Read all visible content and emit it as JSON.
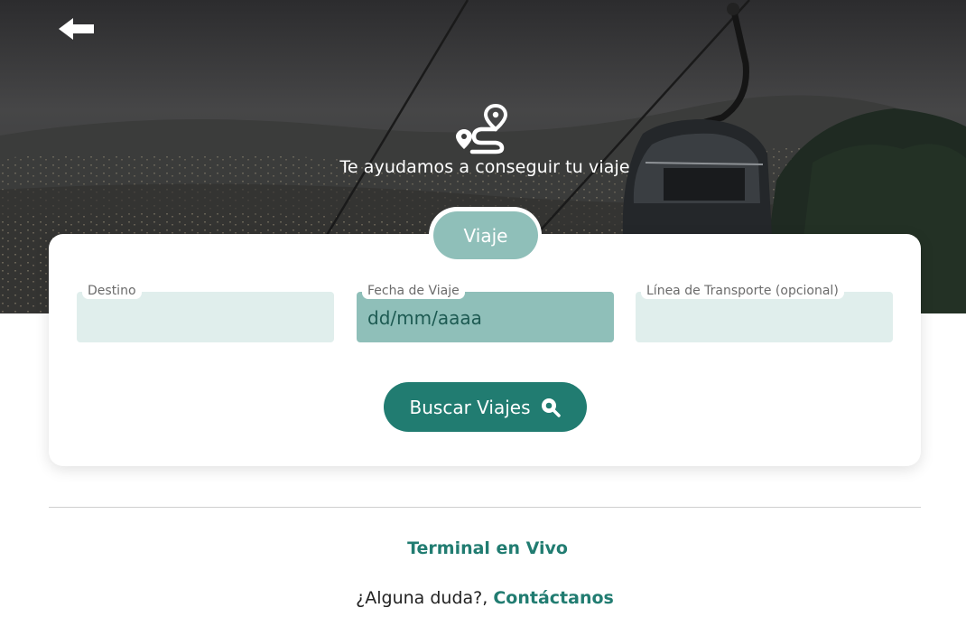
{
  "header": {
    "back_icon": "arrow-left-icon",
    "route_icon": "route-pin-icon",
    "tagline": "Te ayudamos a conseguir tu viaje"
  },
  "search_card": {
    "tab_label": "Viaje",
    "fields": [
      {
        "label": "Destino",
        "value": ""
      },
      {
        "label": "Fecha de Viaje",
        "value": "dd/mm/aaaa"
      },
      {
        "label": "Línea de Transporte (opcional)",
        "value": ""
      }
    ],
    "search_button": {
      "label": "Buscar Viajes",
      "icon": "search-icon"
    }
  },
  "footer": {
    "terminal_link": "Terminal en Vivo",
    "question": "¿Alguna duda?,",
    "contact_link": "Contáctanos"
  },
  "colors": {
    "primary": "#217c71",
    "tab": "#8fbfb9",
    "field_bg": "#e0eeec",
    "field_active_bg": "#8fbfb9"
  }
}
